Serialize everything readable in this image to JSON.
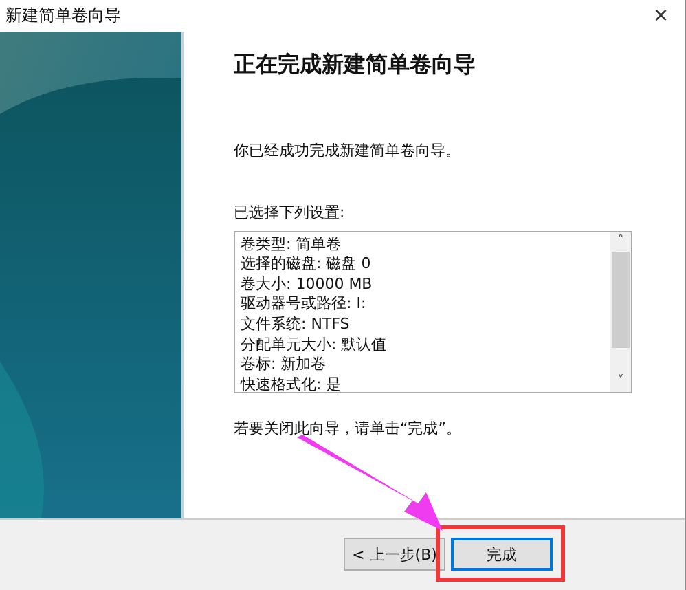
{
  "window": {
    "title": "新建简单卷向导",
    "close": "×"
  },
  "heading": "正在完成新建简单卷向导",
  "intro": "你已经成功完成新建简单卷向导。",
  "settings_label": "已选择下列设置:",
  "settings": [
    "卷类型: 简单卷",
    "选择的磁盘: 磁盘 0",
    "卷大小: 10000 MB",
    "驱动器号或路径: I:",
    "文件系统: NTFS",
    "分配单元大小: 默认值",
    "卷标: 新加卷",
    "快速格式化: 是"
  ],
  "scroll": {
    "up": "˄",
    "down": "˅"
  },
  "close_hint": "若要关闭此向导，请单击“完成”。",
  "buttons": [
    {
      "label": "< 上一步(B)",
      "default": false,
      "highlighted": false
    },
    {
      "label": "完成",
      "default": true,
      "highlighted": true
    }
  ]
}
